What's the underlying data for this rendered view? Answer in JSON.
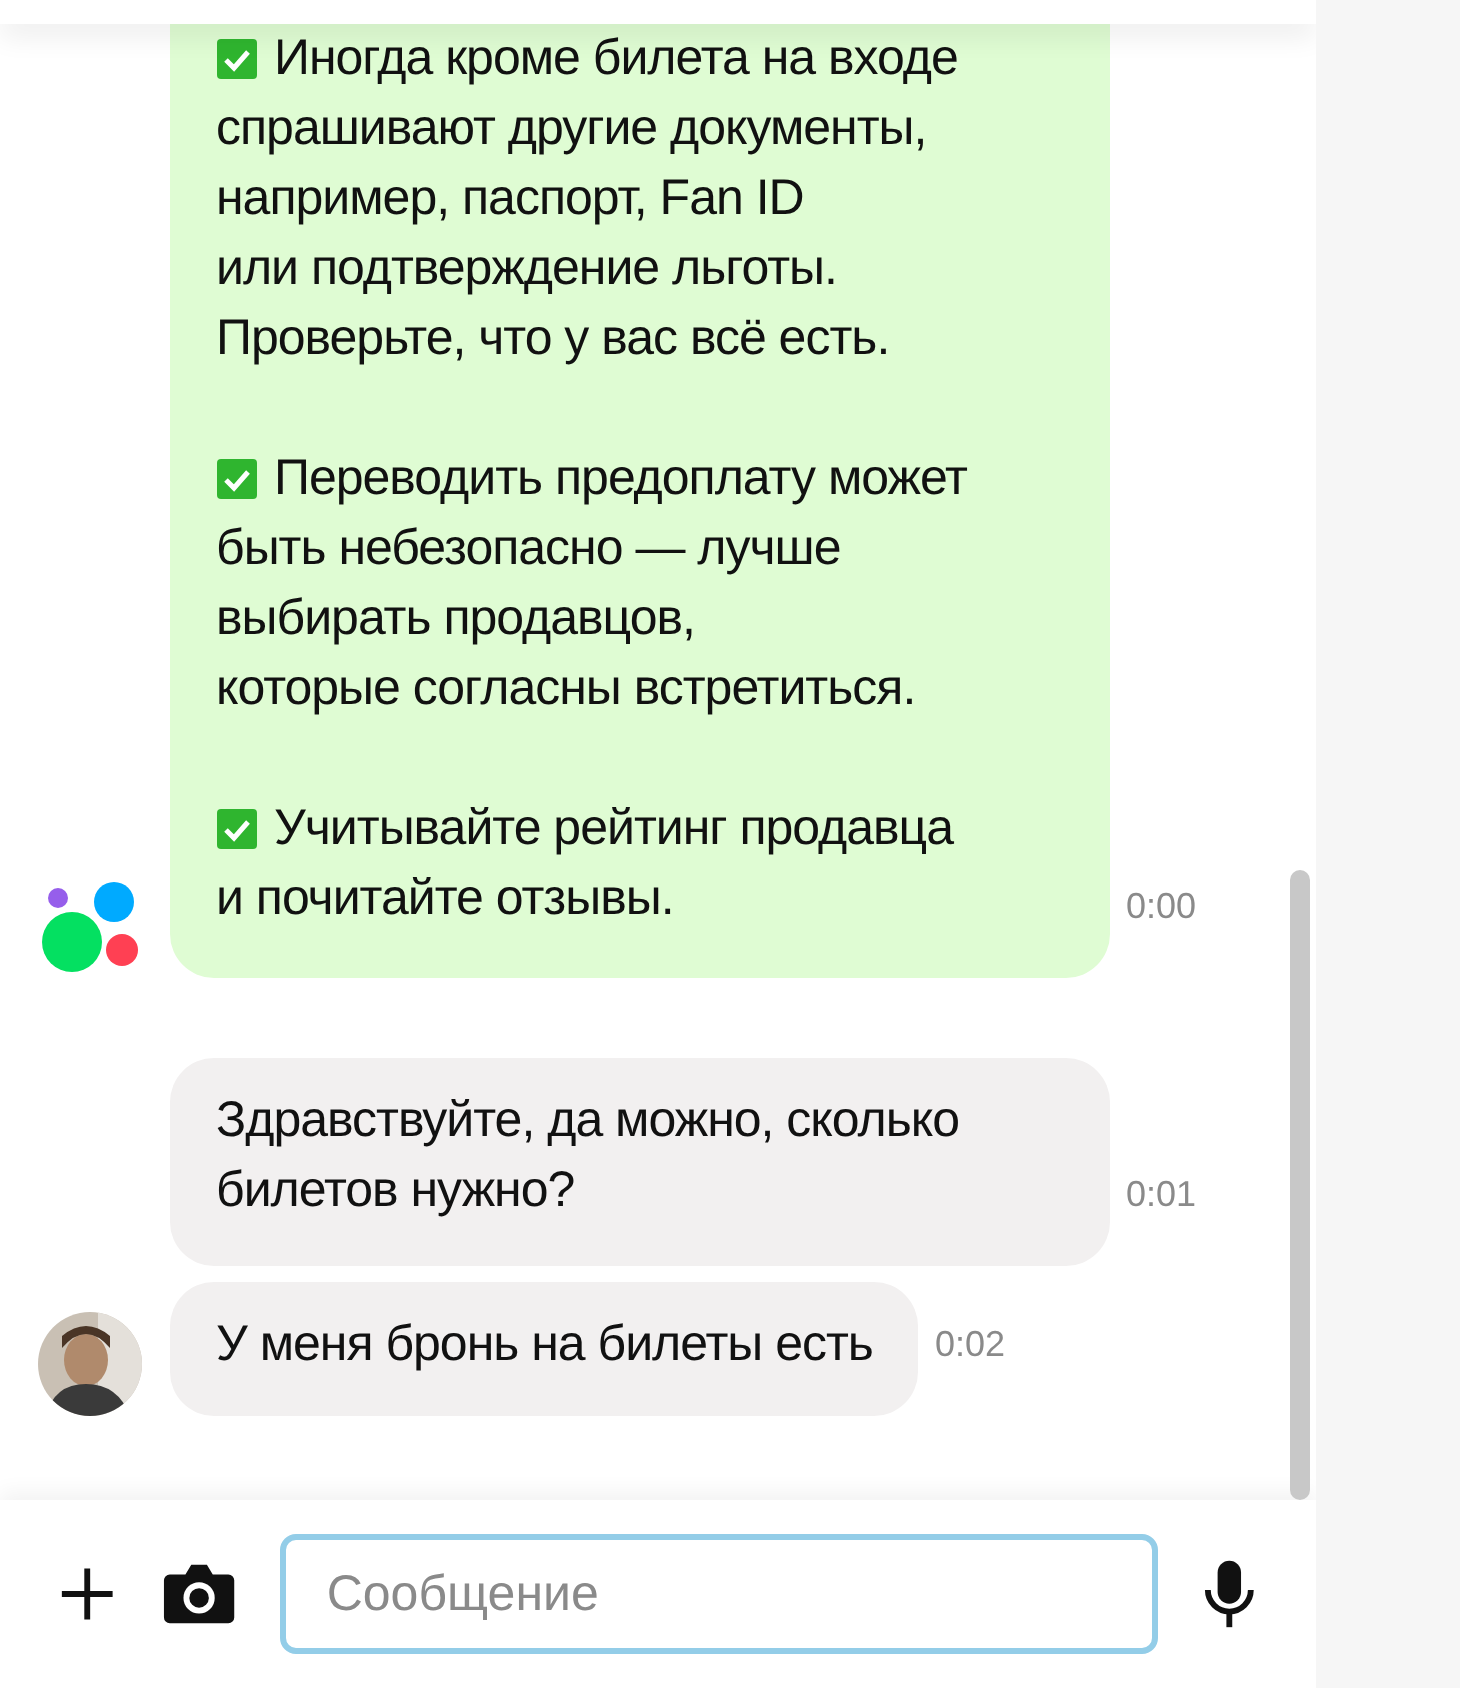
{
  "messages": [
    {
      "kind": "bot",
      "avatar_shown": true,
      "time": "0:00",
      "paragraphs": [
        {
          "lines": [
            "Иногда кроме билета на входе",
            "спрашивают другие документы,",
            "например, паспорт, Fan ID",
            "или подтверждение льготы.",
            "Проверьте, что у вас всё есть."
          ]
        },
        {
          "lines": [
            "Переводить предоплату может",
            "быть небезопасно — лучше",
            "выбирать продавцов,",
            "которые согласны встретиться."
          ]
        },
        {
          "lines": [
            "Учитывайте рейтинг продавца",
            "и почитайте отзывы."
          ]
        }
      ]
    },
    {
      "kind": "person",
      "avatar_shown": false,
      "time": "0:01",
      "paragraphs": [
        {
          "lines": [
            "Здравствуйте, да можно, сколько",
            "билетов нужно?"
          ]
        }
      ]
    },
    {
      "kind": "person",
      "avatar_shown": true,
      "time": "0:02",
      "paragraphs": [
        {
          "lines": [
            "У меня бронь на билеты есть"
          ]
        }
      ]
    }
  ],
  "composer": {
    "placeholder": "Сообщение"
  }
}
